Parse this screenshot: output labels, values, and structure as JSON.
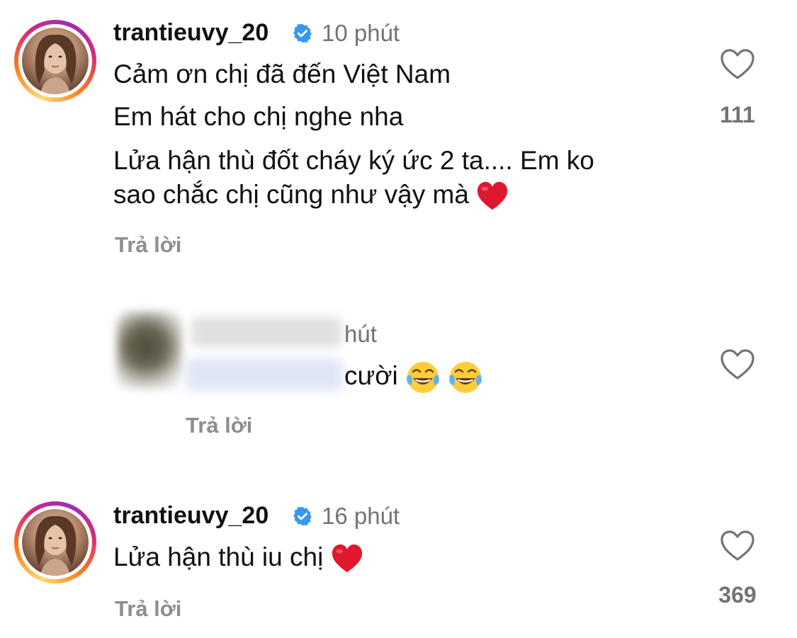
{
  "comments": [
    {
      "username": "trantieuvy_20",
      "time": "10 phút",
      "lines": [
        "Cảm ơn chị đã đến Việt Nam",
        "Em hát cho chị nghe nha",
        "Lửa hận thù đốt cháy ký ức 2 ta.... Em ko",
        "sao chắc chị cũng như vậy mà"
      ],
      "emoji": [
        "red-heart"
      ],
      "reply_label": "Trả lời",
      "likes": "111"
    },
    {
      "time_partial": "hút",
      "text_partial": "cười",
      "emoji": [
        "tears-of-joy",
        "tears-of-joy"
      ],
      "reply_label": "Trả lời",
      "likes": ""
    },
    {
      "username": "trantieuvy_20",
      "time": "16 phút",
      "lines": [
        "Lửa hận thù iu chị"
      ],
      "emoji": [
        "red-heart"
      ],
      "reply_label": "Trả lời",
      "likes": "369"
    }
  ],
  "icons": {
    "like": "heart-outline-icon",
    "verified": "verified-badge-icon"
  },
  "colors": {
    "verified_blue": "#3897f0",
    "secondary_text": "#737373",
    "reply_text": "#8e8e8e",
    "heart_red": "#e0182d"
  }
}
